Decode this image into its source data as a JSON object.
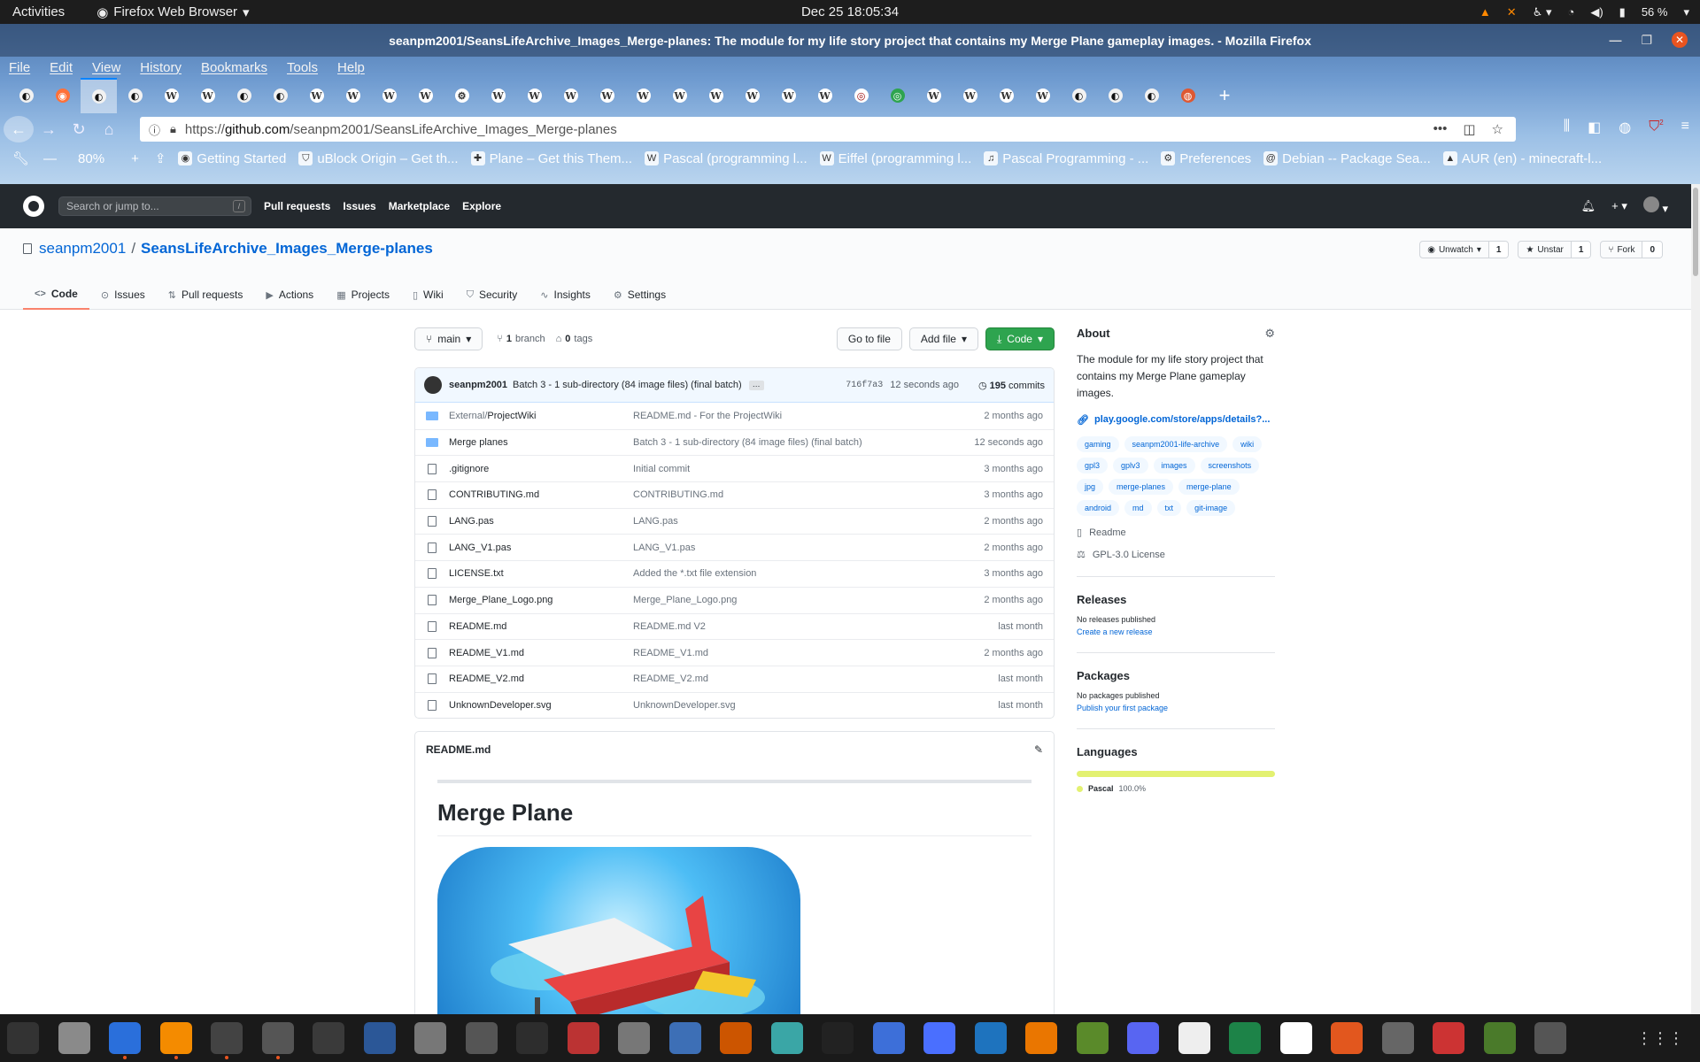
{
  "system": {
    "activities": "Activities",
    "app_name": "Firefox Web Browser",
    "clock": "Dec 25  18:05:34",
    "battery": "56 %"
  },
  "browser": {
    "window_title": "seanpm2001/SeansLifeArchive_Images_Merge-planes: The module for my life story project that contains my Merge Plane gameplay images. - Mozilla Firefox",
    "menu": [
      "File",
      "Edit",
      "View",
      "History",
      "Bookmarks",
      "Tools",
      "Help"
    ],
    "tab_favicons": [
      "github",
      "firefox",
      "github",
      "github",
      "wikipedia",
      "wikipedia",
      "github",
      "github",
      "wikipedia",
      "wikipedia",
      "wikipedia",
      "wikipedia",
      "settings",
      "wikipedia",
      "wikipedia",
      "wikipedia",
      "wikipedia",
      "wikipedia",
      "wikipedia",
      "wikipedia",
      "wikipedia",
      "wikipedia",
      "wikipedia",
      "wikimedia",
      "wikimedia-green",
      "wikipedia",
      "wikipedia",
      "wikipedia",
      "wikipedia",
      "github",
      "github",
      "github",
      "duckduckgo"
    ],
    "url_prefix": "https://",
    "url_host": "github.com",
    "url_path": "/seanpm2001/SeansLifeArchive_Images_Merge-planes",
    "zoom": "80%",
    "addon_badge": "2",
    "bookmarks": [
      {
        "label": "Getting Started",
        "icon": "firefox-icon"
      },
      {
        "label": "uBlock Origin – Get th...",
        "icon": "ublock-icon"
      },
      {
        "label": "Plane – Get this Them...",
        "icon": "puzzle-icon"
      },
      {
        "label": "Pascal (programming l...",
        "icon": "wikipedia-icon"
      },
      {
        "label": "Eiffel (programming l...",
        "icon": "wikipedia-icon"
      },
      {
        "label": "Pascal Programming - ...",
        "icon": "bookmark-icon"
      },
      {
        "label": "Preferences",
        "icon": "gear-icon"
      },
      {
        "label": "Debian -- Package Sea...",
        "icon": "debian-icon"
      },
      {
        "label": "AUR (en) - minecraft-l...",
        "icon": "arch-icon"
      }
    ]
  },
  "github": {
    "search_placeholder": "Search or jump to...",
    "search_hotkey": "/",
    "nav": [
      "Pull requests",
      "Issues",
      "Marketplace",
      "Explore"
    ],
    "owner": "seanpm2001",
    "repo": "SeansLifeArchive_Images_Merge-planes",
    "actions": {
      "watch_label": "Unwatch",
      "watch_count": "1",
      "star_label": "Unstar",
      "star_count": "1",
      "fork_label": "Fork",
      "fork_count": "0"
    },
    "tabs": [
      {
        "label": "Code",
        "icon": "code-icon"
      },
      {
        "label": "Issues",
        "icon": "issue-icon"
      },
      {
        "label": "Pull requests",
        "icon": "pr-icon"
      },
      {
        "label": "Actions",
        "icon": "play-icon"
      },
      {
        "label": "Projects",
        "icon": "project-icon"
      },
      {
        "label": "Wiki",
        "icon": "book-icon"
      },
      {
        "label": "Security",
        "icon": "shield-icon"
      },
      {
        "label": "Insights",
        "icon": "graph-icon"
      },
      {
        "label": "Settings",
        "icon": "gear-icon"
      }
    ],
    "branch": "main",
    "branch_count": "1",
    "branch_word": "branch",
    "tag_count": "0",
    "tag_word": "tags",
    "go_to_file": "Go to file",
    "add_file": "Add file",
    "code_button": "Code",
    "commit": {
      "author": "seanpm2001",
      "message": "Batch 3 - 1 sub-directory (84 image files) (final batch)",
      "ellipsis": "…",
      "sha": "716f7a3",
      "time": "12 seconds ago",
      "count": "195",
      "count_word": "commits"
    },
    "files": [
      {
        "type": "dir",
        "prefix": "External/",
        "name": "ProjectWiki",
        "message": "README.md - For the ProjectWiki",
        "age": "2 months ago"
      },
      {
        "type": "dir",
        "prefix": "",
        "name": "Merge planes",
        "message": "Batch 3 - 1 sub-directory (84 image files) (final batch)",
        "age": "12 seconds ago"
      },
      {
        "type": "file",
        "prefix": "",
        "name": ".gitignore",
        "message": "Initial commit",
        "age": "3 months ago"
      },
      {
        "type": "file",
        "prefix": "",
        "name": "CONTRIBUTING.md",
        "message": "CONTRIBUTING.md",
        "age": "3 months ago"
      },
      {
        "type": "file",
        "prefix": "",
        "name": "LANG.pas",
        "message": "LANG.pas",
        "age": "2 months ago"
      },
      {
        "type": "file",
        "prefix": "",
        "name": "LANG_V1.pas",
        "message": "LANG_V1.pas",
        "age": "2 months ago"
      },
      {
        "type": "file",
        "prefix": "",
        "name": "LICENSE.txt",
        "message": "Added the *.txt file extension",
        "age": "3 months ago"
      },
      {
        "type": "file",
        "prefix": "",
        "name": "Merge_Plane_Logo.png",
        "message": "Merge_Plane_Logo.png",
        "age": "2 months ago"
      },
      {
        "type": "file",
        "prefix": "",
        "name": "README.md",
        "message": "README.md V2",
        "age": "last month"
      },
      {
        "type": "file",
        "prefix": "",
        "name": "README_V1.md",
        "message": "README_V1.md",
        "age": "2 months ago"
      },
      {
        "type": "file",
        "prefix": "",
        "name": "README_V2.md",
        "message": "README_V2.md",
        "age": "last month"
      },
      {
        "type": "file",
        "prefix": "",
        "name": "UnknownDeveloper.svg",
        "message": "UnknownDeveloper.svg",
        "age": "last month"
      }
    ],
    "readme": {
      "filename": "README.md",
      "heading": "Merge Plane"
    },
    "about": {
      "title": "About",
      "description": "The module for my life story project that contains my Merge Plane gameplay images.",
      "link": "play.google.com/store/apps/details?...",
      "topics": [
        "gaming",
        "seanpm2001-life-archive",
        "wiki",
        "gpl3",
        "gplv3",
        "images",
        "screenshots",
        "jpg",
        "merge-planes",
        "merge-plane",
        "android",
        "md",
        "txt",
        "git-image"
      ],
      "readme_label": "Readme",
      "license_label": "GPL-3.0 License"
    },
    "releases": {
      "title": "Releases",
      "empty": "No releases published",
      "link": "Create a new release"
    },
    "packages": {
      "title": "Packages",
      "empty": "No packages published",
      "link": "Publish your first package"
    },
    "languages": {
      "title": "Languages",
      "name": "Pascal",
      "percent": "100.0%",
      "color": "#e3f171",
      "share": 1.0
    }
  },
  "dock": [
    "system-monitor",
    "files",
    "text-editor",
    "vlc",
    "firefox",
    "calculator",
    "extensions",
    "office-writer",
    "settings",
    "image-viewer",
    "terminal",
    "waveform",
    "app-center",
    "photo-editor",
    "mail",
    "calendar",
    "inkscape",
    "todo",
    "screenshot",
    "virtualbox",
    "blender",
    "minecraft-launcher",
    "discord",
    "file",
    "spreadsheet",
    "typora",
    "presentation",
    "gimp",
    "mario",
    "minecraft",
    "maps"
  ]
}
